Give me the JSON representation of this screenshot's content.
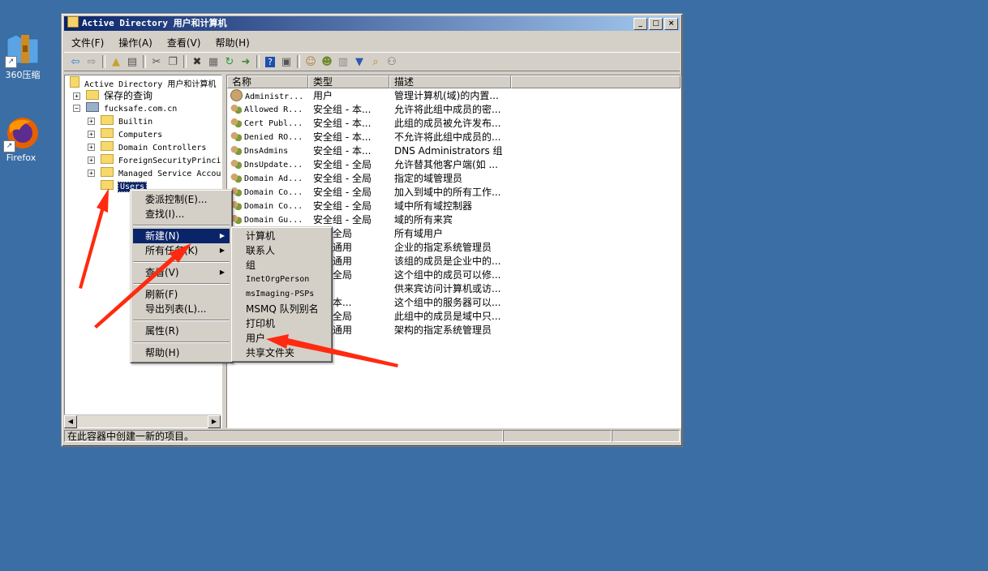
{
  "desktop": {
    "icons": [
      {
        "label": "360压缩",
        "icon": "archive-icon"
      },
      {
        "label": "Firefox",
        "icon": "firefox-icon"
      }
    ]
  },
  "window": {
    "title": "Active Directory 用户和计算机",
    "menu": [
      "文件(F)",
      "操作(A)",
      "查看(V)",
      "帮助(H)"
    ]
  },
  "tree": {
    "root": "Active Directory 用户和计算机",
    "saved": "保存的查询",
    "domain": "fucksafe.com.cn",
    "children": [
      "Builtin",
      "Computers",
      "Domain Controllers",
      "ForeignSecurityPrincipals",
      "Managed Service Accounts",
      "Users"
    ]
  },
  "list": {
    "headers": [
      "名称",
      "类型",
      "描述"
    ],
    "rows": [
      {
        "name": "Administr...",
        "type": "用户",
        "desc": "管理计算机(域)的内置...",
        "icon": "user-icon"
      },
      {
        "name": "Allowed R...",
        "type": "安全组 - 本...",
        "desc": "允许将此组中成员的密...",
        "icon": "group-icon"
      },
      {
        "name": "Cert Publ...",
        "type": "安全组 - 本...",
        "desc": "此组的成员被允许发布...",
        "icon": "group-icon"
      },
      {
        "name": "Denied RO...",
        "type": "安全组 - 本...",
        "desc": "不允许将此组中成员的...",
        "icon": "group-icon"
      },
      {
        "name": "DnsAdmins",
        "type": "安全组 - 本...",
        "desc": "DNS Administrators 组",
        "icon": "group-icon"
      },
      {
        "name": "DnsUpdate...",
        "type": "安全组 - 全局",
        "desc": "允许替其他客户端(如 ...",
        "icon": "group-icon"
      },
      {
        "name": "Domain Ad...",
        "type": "安全组 - 全局",
        "desc": "指定的域管理员",
        "icon": "group-icon"
      },
      {
        "name": "Domain Co...",
        "type": "安全组 - 全局",
        "desc": "加入到域中的所有工作...",
        "icon": "group-icon"
      },
      {
        "name": "Domain Co...",
        "type": "安全组 - 全局",
        "desc": "域中所有域控制器",
        "icon": "group-icon"
      },
      {
        "name": "Domain Gu...",
        "type": "安全组 - 全局",
        "desc": "域的所有来宾",
        "icon": "group-icon"
      },
      {
        "name": "",
        "type": "组 - 全局",
        "desc": "所有域用户",
        "icon": ""
      },
      {
        "name": "",
        "type": "组 - 通用",
        "desc": "企业的指定系统管理员",
        "icon": ""
      },
      {
        "name": "",
        "type": "组 - 通用",
        "desc": "该组的成员是企业中的...",
        "icon": ""
      },
      {
        "name": "",
        "type": "组 - 全局",
        "desc": "这个组中的成员可以修...",
        "icon": ""
      },
      {
        "name": "",
        "type": "",
        "desc": "供来宾访问计算机或访...",
        "icon": ""
      },
      {
        "name": "",
        "type": "组 - 本...",
        "desc": "这个组中的服务器可以...",
        "icon": ""
      },
      {
        "name": "",
        "type": "组 - 全局",
        "desc": "此组中的成员是域中只...",
        "icon": ""
      },
      {
        "name": "",
        "type": "组 - 通用",
        "desc": "架构的指定系统管理员",
        "icon": ""
      }
    ]
  },
  "context_menu": {
    "items": [
      "委派控制(E)...",
      "查找(I)...",
      "新建(N)",
      "所有任务(K)",
      "查看(V)",
      "刷新(F)",
      "导出列表(L)...",
      "属性(R)",
      "帮助(H)"
    ]
  },
  "submenu": {
    "items": [
      "计算机",
      "联系人",
      "组",
      "InetOrgPerson",
      "msImaging-PSPs",
      "MSMQ 队列别名",
      "打印机",
      "用户",
      "共享文件夹"
    ]
  },
  "status": {
    "text": "在此容器中创建一新的项目。"
  },
  "colors": {
    "desktop": "#3a6ea5",
    "title_start": "#0a246a",
    "title_end": "#a6caf0",
    "highlight": "#0a246a",
    "annotation_arrow": "#ff2a10"
  }
}
